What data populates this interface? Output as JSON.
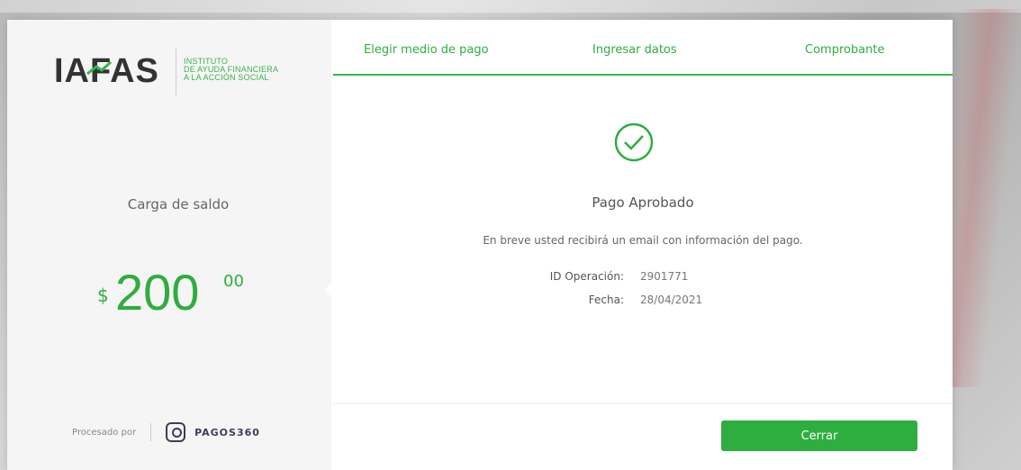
{
  "brand": {
    "logo_text": "IAFAS",
    "logo_sub_line1": "INSTITUTO",
    "logo_sub_line2": "DE AYUDA FINANCIERA",
    "logo_sub_line3": "A LA ACCIÓN SOCIAL",
    "accent_color": "#2eae3e"
  },
  "summary": {
    "label": "Carga de saldo",
    "currency": "$",
    "amount_int": "200",
    "amount_dec": "00"
  },
  "processor": {
    "label": "Procesado por",
    "name": "PAGOS360"
  },
  "steps": [
    {
      "label": "Elegir medio de pago"
    },
    {
      "label": "Ingresar datos"
    },
    {
      "label": "Comprobante"
    }
  ],
  "result": {
    "icon": "check-circle-icon",
    "title": "Pago Aprobado",
    "message": "En breve usted recibirá un email con información del pago.",
    "fields": [
      {
        "label": "ID Operación:",
        "value": "2901771"
      },
      {
        "label": "Fecha:",
        "value": "28/04/2021"
      }
    ]
  },
  "actions": {
    "close_label": "Cerrar"
  }
}
